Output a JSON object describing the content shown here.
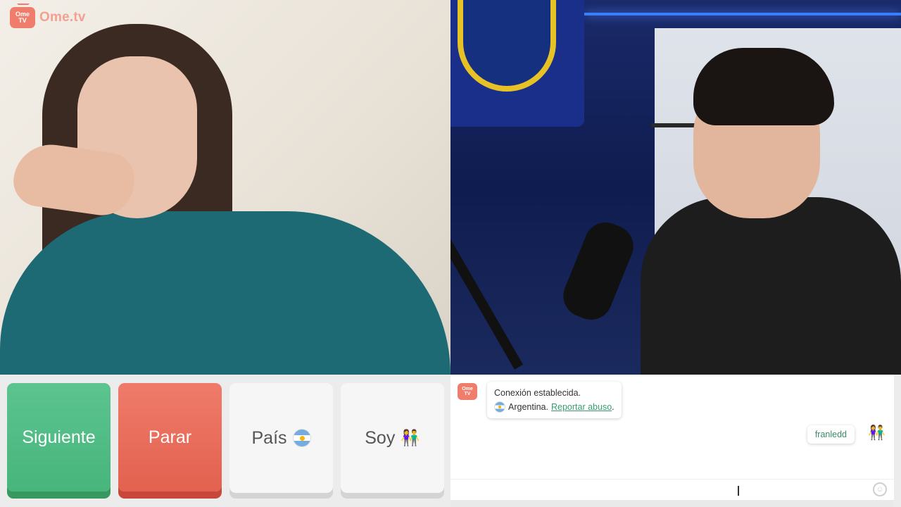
{
  "app": {
    "logo_small": "Ome",
    "logo_small2": "TV",
    "logo_text": "Ome.tv"
  },
  "controls": {
    "next_label": "Siguiente",
    "stop_label": "Parar",
    "country_label": "País",
    "gender_label": "Soy",
    "country_flag": "argentina-flag-icon",
    "gender_icon": "couple-icon"
  },
  "chat": {
    "system_icon_top": "Ome",
    "system_icon_bottom": "TV",
    "system_line1": "Conexión establecida.",
    "system_country": "Argentina.",
    "report_link": "Reportar abuso",
    "report_suffix": ".",
    "user_message": "franledd",
    "input_placeholder": ""
  },
  "colors": {
    "next": "#4cb982",
    "stop": "#e76a58",
    "accent_link": "#3a9b72",
    "logo": "#f07c6c"
  }
}
